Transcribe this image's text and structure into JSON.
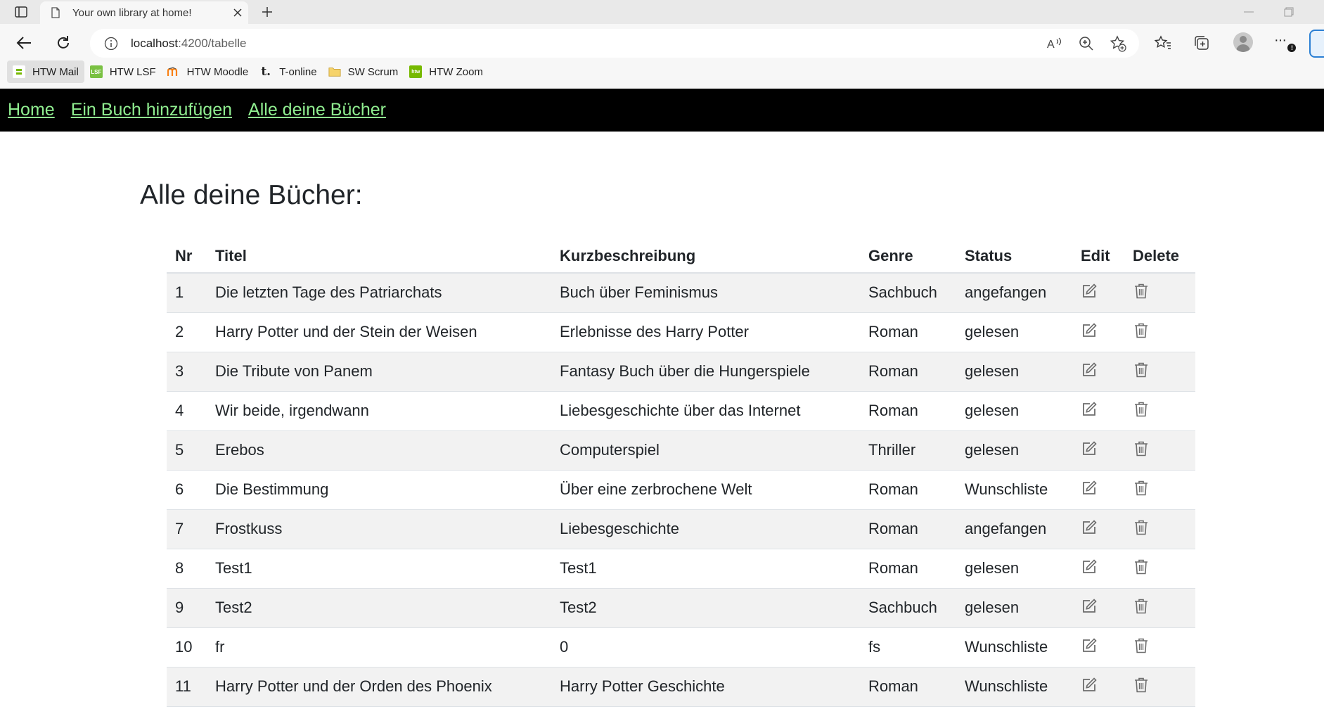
{
  "browser": {
    "tab_title": "Your own library at home!",
    "url_host": "localhost",
    "url_path": ":4200/tabelle",
    "bookmarks": [
      {
        "label": "HTW Mail",
        "icon": "htw-mail-icon"
      },
      {
        "label": "HTW LSF",
        "icon": "lsf-icon"
      },
      {
        "label": "HTW Moodle",
        "icon": "moodle-icon"
      },
      {
        "label": "T-online",
        "icon": "t-online-icon"
      },
      {
        "label": "SW Scrum",
        "icon": "folder-icon"
      },
      {
        "label": "HTW Zoom",
        "icon": "htw-zoom-icon"
      }
    ],
    "bookmark_icon_text": {
      "lsf": "LSF",
      "t_online": "t.",
      "zoom": "htw"
    }
  },
  "nav": {
    "home": "Home",
    "add_book": "Ein Buch hinzufügen",
    "all_books": "Alle deine Bücher"
  },
  "page": {
    "title": "Alle deine Bücher:"
  },
  "table": {
    "headers": {
      "nr": "Nr",
      "title": "Titel",
      "description": "Kurzbeschreibung",
      "genre": "Genre",
      "status": "Status",
      "edit": "Edit",
      "delete": "Delete"
    },
    "rows": [
      {
        "nr": "1",
        "title": "Die letzten Tage des Patriarchats",
        "description": "Buch über Feminismus",
        "genre": "Sachbuch",
        "status": "angefangen"
      },
      {
        "nr": "2",
        "title": "Harry Potter und der Stein der Weisen",
        "description": "Erlebnisse des Harry Potter",
        "genre": "Roman",
        "status": "gelesen"
      },
      {
        "nr": "3",
        "title": "Die Tribute von Panem",
        "description": "Fantasy Buch über die Hungerspiele",
        "genre": "Roman",
        "status": "gelesen"
      },
      {
        "nr": "4",
        "title": "Wir beide, irgendwann",
        "description": "Liebesgeschichte über das Internet",
        "genre": "Roman",
        "status": "gelesen"
      },
      {
        "nr": "5",
        "title": "Erebos",
        "description": "Computerspiel",
        "genre": "Thriller",
        "status": "gelesen"
      },
      {
        "nr": "6",
        "title": "Die Bestimmung",
        "description": "Über eine zerbrochene Welt",
        "genre": "Roman",
        "status": "Wunschliste"
      },
      {
        "nr": "7",
        "title": "Frostkuss",
        "description": "Liebesgeschichte",
        "genre": "Roman",
        "status": "angefangen"
      },
      {
        "nr": "8",
        "title": "Test1",
        "description": "Test1",
        "genre": "Roman",
        "status": "gelesen"
      },
      {
        "nr": "9",
        "title": "Test2",
        "description": "Test2",
        "genre": "Sachbuch",
        "status": "gelesen"
      },
      {
        "nr": "10",
        "title": "fr",
        "description": "0",
        "genre": "fs",
        "status": "Wunschliste"
      },
      {
        "nr": "11",
        "title": "Harry Potter und der Orden des Phoenix",
        "description": "Harry Potter Geschichte",
        "genre": "Roman",
        "status": "Wunschliste"
      }
    ]
  },
  "colors": {
    "nav_bg": "#000000",
    "nav_link": "#90ee90",
    "row_stripe": "#f2f2f2",
    "icon_gray": "#6c6c6c"
  }
}
